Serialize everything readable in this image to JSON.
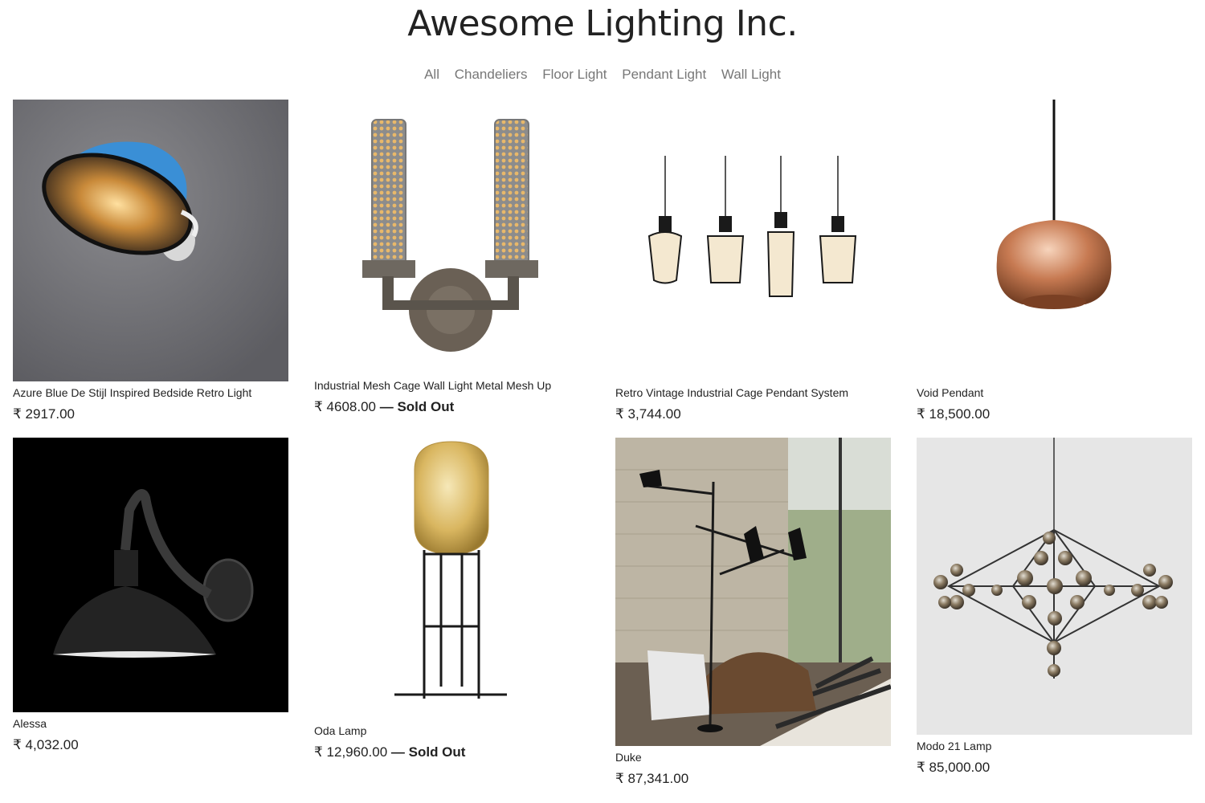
{
  "header": {
    "title": "Awesome Lighting Inc."
  },
  "nav": [
    "All",
    "Chandeliers",
    "Floor Light",
    "Pendant Light",
    "Wall Light"
  ],
  "products": [
    {
      "title": "Azure Blue De Stijl Inspired Bedside Retro Light",
      "price": "₹ 2917.00",
      "sold_out": ""
    },
    {
      "title": "Industrial Mesh Cage Wall Light Metal Mesh Up",
      "price": "₹ 4608.00",
      "sold_out": " — Sold Out"
    },
    {
      "title": "Retro Vintage Industrial Cage Pendant System",
      "price": "₹ 3,744.00",
      "sold_out": ""
    },
    {
      "title": "Void Pendant",
      "price": "₹ 18,500.00",
      "sold_out": ""
    },
    {
      "title": "Alessa",
      "price": "₹ 4,032.00",
      "sold_out": ""
    },
    {
      "title": "Oda Lamp",
      "price": "₹ 12,960.00",
      "sold_out": " — Sold Out"
    },
    {
      "title": "Duke",
      "price": "₹ 87,341.00",
      "sold_out": ""
    },
    {
      "title": "Modo 21 Lamp",
      "price": "₹ 85,000.00",
      "sold_out": ""
    }
  ]
}
